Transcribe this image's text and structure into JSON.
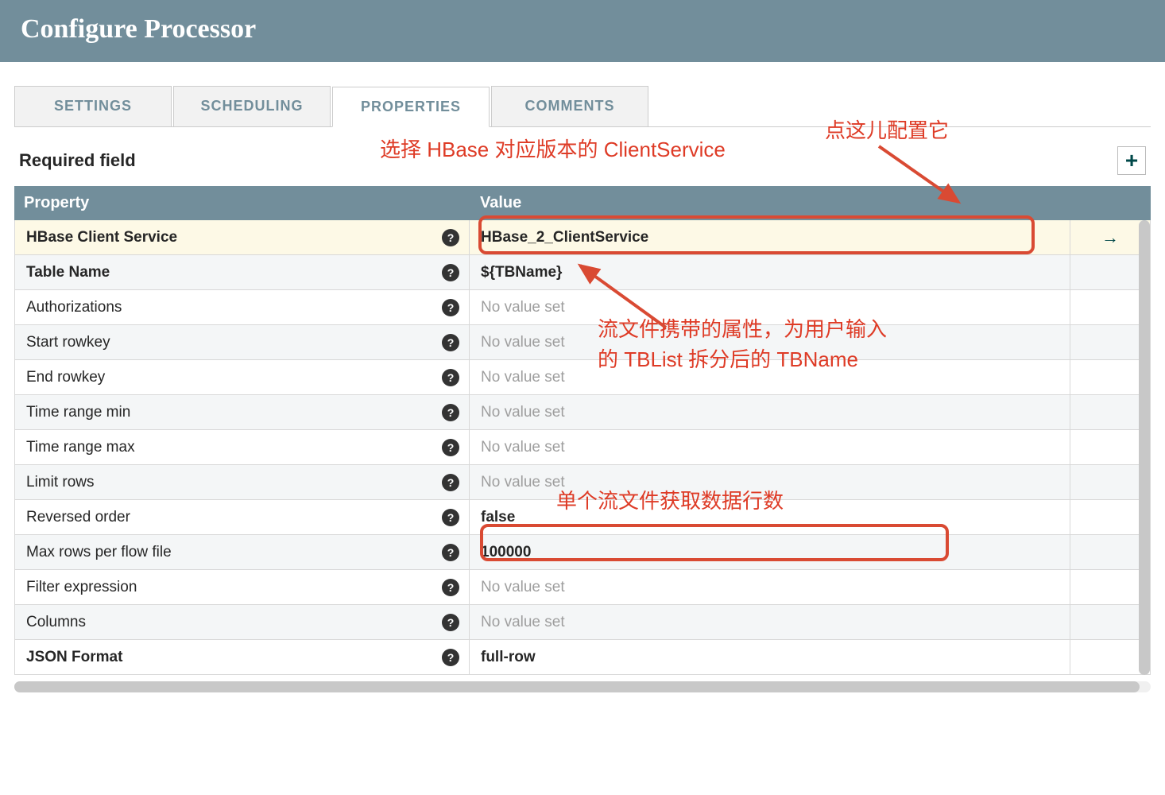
{
  "header": {
    "title": "Configure Processor"
  },
  "tabs": {
    "settings": "SETTINGS",
    "scheduling": "SCHEDULING",
    "properties": "PROPERTIES",
    "comments": "COMMENTS"
  },
  "required_label": "Required field",
  "table": {
    "head_property": "Property",
    "head_value": "Value",
    "no_value": "No value set"
  },
  "rows": [
    {
      "name": "HBase Client Service",
      "bold": true,
      "value": "HBase_2_ClientService",
      "set": true,
      "goto": true,
      "highlight": true
    },
    {
      "name": "Table Name",
      "bold": true,
      "value": "${TBName}",
      "set": true
    },
    {
      "name": "Authorizations",
      "bold": false,
      "value": "",
      "set": false
    },
    {
      "name": "Start rowkey",
      "bold": false,
      "value": "",
      "set": false
    },
    {
      "name": "End rowkey",
      "bold": false,
      "value": "",
      "set": false
    },
    {
      "name": "Time range min",
      "bold": false,
      "value": "",
      "set": false
    },
    {
      "name": "Time range max",
      "bold": false,
      "value": "",
      "set": false
    },
    {
      "name": "Limit rows",
      "bold": false,
      "value": "",
      "set": false
    },
    {
      "name": "Reversed order",
      "bold": false,
      "value": "false",
      "set": true
    },
    {
      "name": "Max rows per flow file",
      "bold": false,
      "value": "100000",
      "set": true
    },
    {
      "name": "Filter expression",
      "bold": false,
      "value": "",
      "set": false
    },
    {
      "name": "Columns",
      "bold": false,
      "value": "",
      "set": false
    },
    {
      "name": "JSON Format",
      "bold": true,
      "value": "full-row",
      "set": true
    }
  ],
  "annotations": {
    "a1": "选择 HBase 对应版本的 ClientService",
    "a2": "点这儿配置它",
    "a3_line1": "流文件携带的属性，为用户输入",
    "a3_line2": "的 TBList 拆分后的 TBName",
    "a4": "单个流文件获取数据行数"
  }
}
